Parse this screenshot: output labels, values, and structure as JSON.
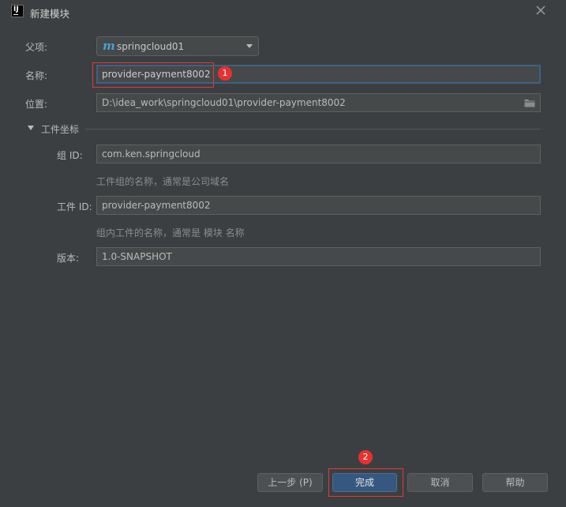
{
  "window": {
    "title": "新建模块"
  },
  "form": {
    "parent": {
      "label": "父项:",
      "value": "springcloud01"
    },
    "name": {
      "label": "名称:",
      "value": "provider-payment8002"
    },
    "location": {
      "label": "位置:",
      "value": "D:\\idea_work\\springcloud01\\provider-payment8002"
    },
    "section": {
      "label": "工件坐标"
    },
    "group_id": {
      "label": "组 ID:",
      "value": "com.ken.springcloud",
      "hint": "工件组的名称，通常是公司域名"
    },
    "artifact_id": {
      "label": "工件 ID:",
      "value": "provider-payment8002",
      "hint": "组内工件的名称，通常是 模块 名称"
    },
    "version": {
      "label": "版本:",
      "value": "1.0-SNAPSHOT"
    }
  },
  "buttons": {
    "previous": "上一步 (P)",
    "finish": "完成",
    "cancel": "取消",
    "help": "帮助"
  },
  "annotations": {
    "one": "1",
    "two": "2"
  },
  "icons": {
    "app": "intellij-icon",
    "close": "close-icon",
    "folder": "folder-icon",
    "maven": "maven-module-icon"
  },
  "colors": {
    "background": "#3c3f41",
    "field": "#45494a",
    "primary": "#365880",
    "annotation": "#e23b3b"
  }
}
